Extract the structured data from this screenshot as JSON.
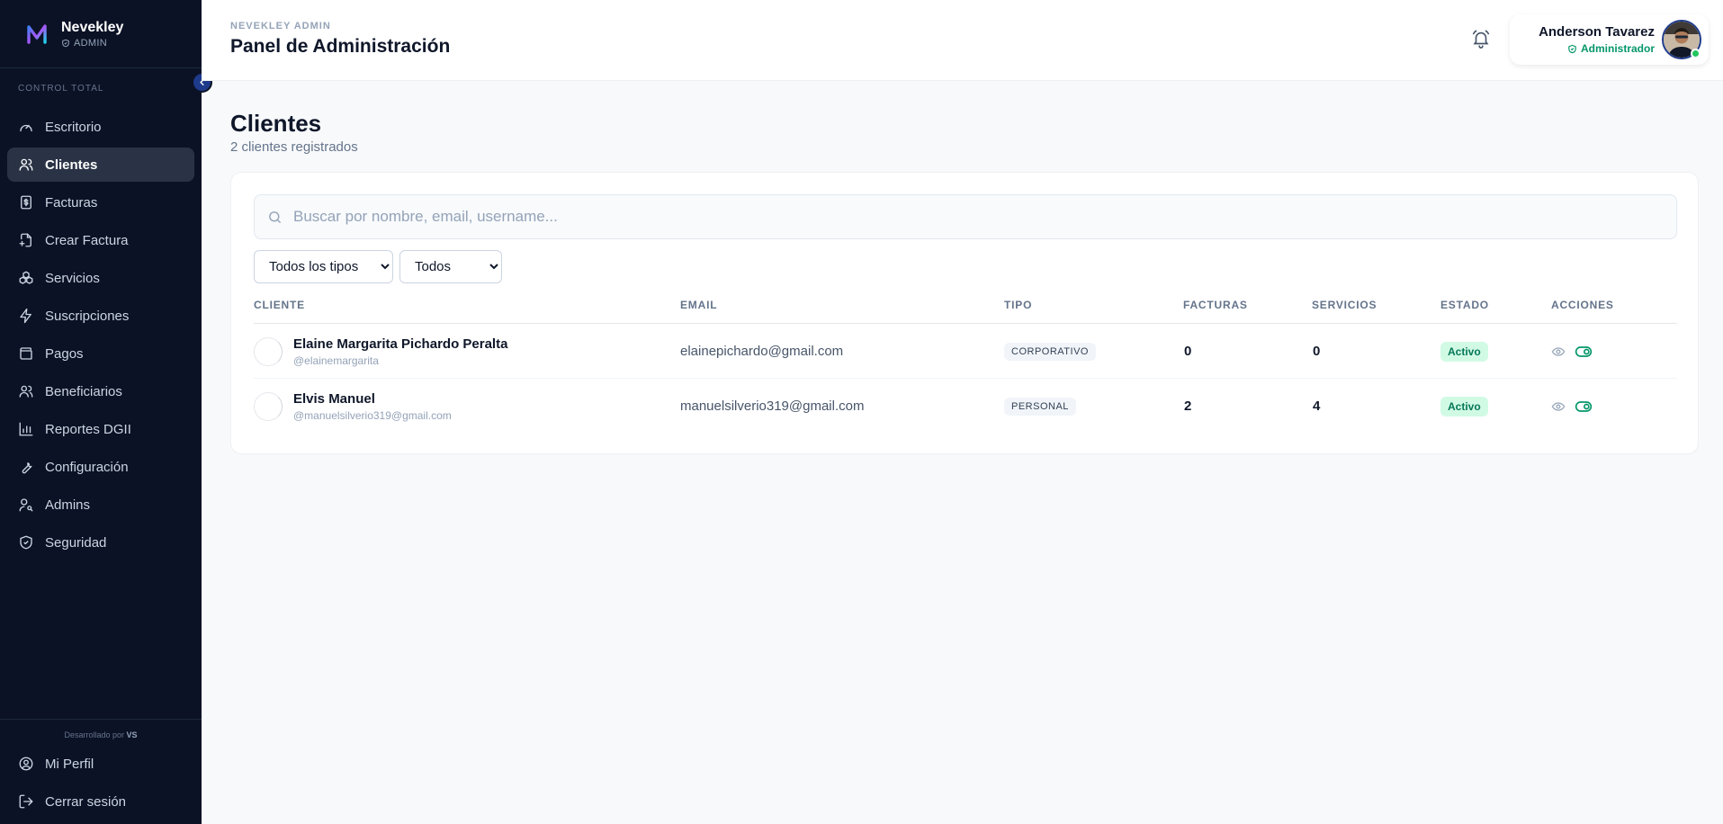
{
  "app": {
    "brand_name": "Nevekley",
    "brand_role": "ADMIN",
    "logo_icon": "nevekley-logo"
  },
  "sidebar": {
    "section_label": "CONTROL TOTAL",
    "items": [
      {
        "label": "Escritorio",
        "icon": "gauge-icon",
        "active": false
      },
      {
        "label": "Clientes",
        "icon": "users-icon",
        "active": true
      },
      {
        "label": "Facturas",
        "icon": "invoice-icon",
        "active": false
      },
      {
        "label": "Crear Factura",
        "icon": "create-invoice-icon",
        "active": false
      },
      {
        "label": "Servicios",
        "icon": "boxes-icon",
        "active": false
      },
      {
        "label": "Suscripciones",
        "icon": "zap-icon",
        "active": false
      },
      {
        "label": "Pagos",
        "icon": "wallet-icon",
        "active": false
      },
      {
        "label": "Beneficiarios",
        "icon": "user-group-icon",
        "active": false
      },
      {
        "label": "Reportes DGII",
        "icon": "bar-chart-icon",
        "active": false
      },
      {
        "label": "Configuración",
        "icon": "wrench-icon",
        "active": false
      },
      {
        "label": "Admins",
        "icon": "user-key-icon",
        "active": false
      },
      {
        "label": "Seguridad",
        "icon": "shield-check-icon",
        "active": false
      }
    ],
    "credit_prefix": "Desarrollado por",
    "credit_author": "VS",
    "footer_items": [
      {
        "label": "Mi Perfil",
        "icon": "user-circle-icon"
      },
      {
        "label": "Cerrar sesión",
        "icon": "logout-icon"
      }
    ]
  },
  "header": {
    "eyebrow": "NEVEKLEY ADMIN",
    "title": "Panel de Administración",
    "user_name": "Anderson Tavarez",
    "user_role": "Administrador"
  },
  "main": {
    "title": "Clientes",
    "subtitle": "2 clientes registrados",
    "search_placeholder": "Buscar por nombre, email, username...",
    "filter_type": {
      "selected": "Todos los tipos"
    },
    "filter_status": {
      "selected": "Todos"
    },
    "columns": [
      "CLIENTE",
      "EMAIL",
      "TIPO",
      "FACTURAS",
      "SERVICIOS",
      "ESTADO",
      "ACCIONES"
    ],
    "rows": [
      {
        "name": "Elaine Margarita Pichardo Peralta",
        "username": "@elainemargarita",
        "email": "elainepichardo@gmail.com",
        "tipo": "CORPORATIVO",
        "facturas": "0",
        "servicios": "0",
        "estado": "Activo"
      },
      {
        "name": "Elvis Manuel",
        "username": "@manuelsilverio319@gmail.com",
        "email": "manuelsilverio319@gmail.com",
        "tipo": "PERSONAL",
        "facturas": "2",
        "servicios": "4",
        "estado": "Activo"
      }
    ]
  },
  "colors": {
    "sidebar_bg": "#0b1226",
    "active_item_bg": "#2a3346",
    "accent_green": "#059669",
    "status_badge_bg": "#d1fae5"
  }
}
